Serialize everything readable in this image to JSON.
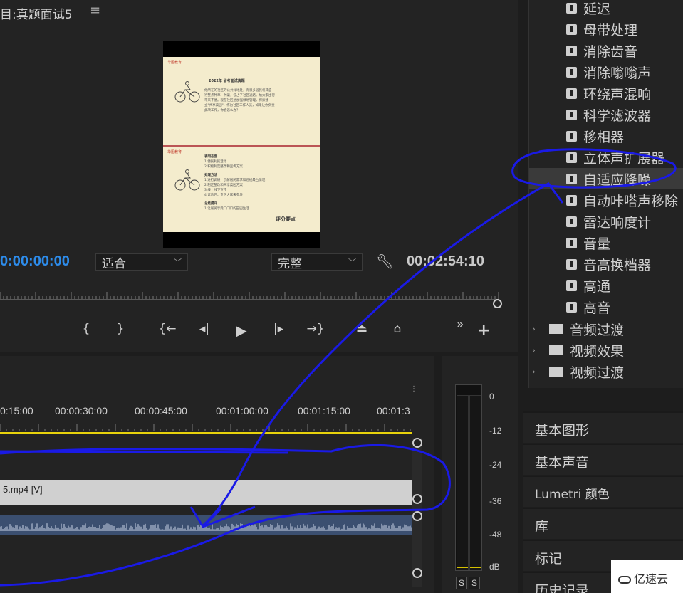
{
  "monitor": {
    "title": "目:真题面试5",
    "timecode": "0:00:00:00",
    "fit_value": "适合",
    "quality_value": "完整",
    "duration": "00:02:54:10"
  },
  "preview_doc": {
    "logo_top": "华图教育",
    "title": "2022年 省考面试真题",
    "paragraph": [
      "你所在的社区的公共绿地处，有很多居民将其自",
      "行整点种草、种菜，侵占了社区通路。给大家出行",
      "带来不便。现在社区想加强绿地管理，探索建",
      "立\"共享菜园\"，作为社区工作人员，如果让你负责",
      "此项工作，你会怎么办？"
    ],
    "logo_bottom": "华图教育",
    "points": [
      "表明态度",
      "1.便民利民活动",
      "2.积极制定整改和宣传方案",
      "",
      "处理方法",
      "1.进行调研，了解居民需求和违规最占情况",
      "2.制定整改和共享菜园方案",
      "3.线上线下宣传",
      "4.试验后，专区大家来参与",
      "",
      "总结提升",
      "1.让居民享受厂门口的田园生活"
    ],
    "score_label": "评分要点"
  },
  "timeline": {
    "time_labels": [
      "0:15:00",
      "00:00:30:00",
      "00:00:45:00",
      "00:01:00:00",
      "00:01:15:00",
      "00:01:3"
    ],
    "video_clip_label": "5.mp4 [V]",
    "menu_dots": "⋮"
  },
  "meter": {
    "db_labels": [
      "0",
      "-12",
      "-24",
      "-36",
      "-48",
      "dB"
    ],
    "solo_labels": [
      "S",
      "S"
    ]
  },
  "effects": {
    "items": [
      "延迟",
      "母带处理",
      "消除齿音",
      "消除嗡嗡声",
      "环绕声混响",
      "科学滤波器",
      "移相器",
      "立体声扩展器",
      "自适应降噪",
      "自动咔嗒声移除",
      "雷达响度计",
      "音量",
      "音高换档器",
      "高通",
      "高音"
    ],
    "selected_index": 8,
    "folders": [
      "音频过渡",
      "视频效果",
      "视频过渡"
    ]
  },
  "side_panels": [
    "基本图形",
    "基本声音",
    "Lumetri 颜色",
    "库",
    "标记",
    "历史记录"
  ],
  "watermark": "亿速云",
  "colors": {
    "timecode_blue": "#2d8ceb",
    "work_area_yellow": "#e8d30c",
    "annotation_blue": "#1a1ae6",
    "audio_clip": "#3b4f70"
  },
  "icons": {
    "wrench": "wrench-icon",
    "effect": "audio-effect-icon",
    "folder": "folder-icon"
  }
}
